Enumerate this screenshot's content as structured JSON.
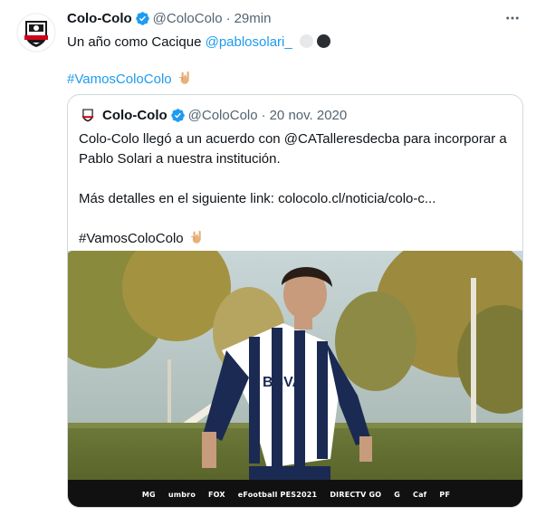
{
  "tweet": {
    "author_name": "Colo-Colo",
    "author_handle": "@ColoColo",
    "separator": "·",
    "time": "29min",
    "text_prefix": "Un año como Cacique ",
    "mention": "@pablosolari_",
    "hashtag": "#VamosColoColo"
  },
  "quoted": {
    "author_name": "Colo-Colo",
    "author_handle": "@ColoColo",
    "separator": "·",
    "date": "20 nov. 2020",
    "line1": "Colo-Colo llegó a un acuerdo con @CATalleresdecba para incorporar a Pablo Solari a nuestra institución.",
    "line2": "Más detalles en el siguiente link: colocolo.cl/noticia/colo-c...",
    "hashtag": "#VamosColoColo"
  },
  "sponsors": [
    "MG",
    "umbro",
    "FOX",
    "eFootball PES2021",
    "DIRECTV GO",
    "G",
    "Caf",
    "PF"
  ],
  "colors": {
    "link": "#1d9bf0",
    "verified": "#1d9bf0",
    "muted": "#536471",
    "border": "#cfd9de"
  },
  "icons": {
    "verified": "verified-badge-icon",
    "more": "more-options-icon",
    "hand": "rock-hand-emoji-icon"
  }
}
